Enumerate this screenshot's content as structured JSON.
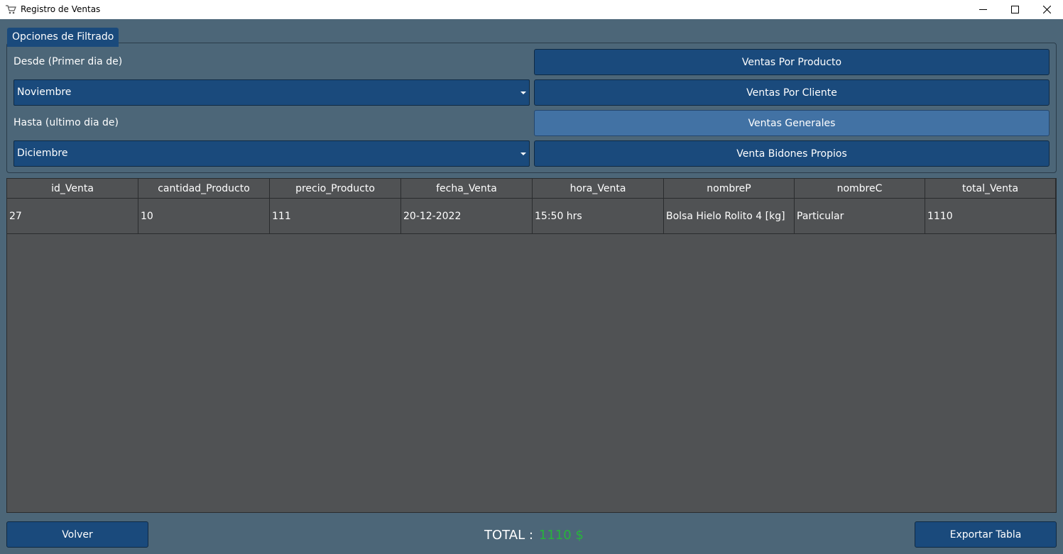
{
  "window": {
    "title": "Registro de Ventas",
    "app_icon": "cart-icon",
    "controls": [
      "minimize-icon",
      "maximize-icon",
      "close-icon"
    ]
  },
  "filter": {
    "group_title": "Opciones de Filtrado",
    "from_label": "Desde (Primer dia de)",
    "from_value": "Noviembre",
    "to_label": "Hasta (ultimo dia de)",
    "to_value": "Diciembre"
  },
  "buttons": {
    "by_product": "Ventas Por Producto",
    "by_client": "Ventas Por Cliente",
    "general": "Ventas Generales",
    "own_jugs": "Venta Bidones Propios",
    "back": "Volver",
    "export": "Exportar Tabla"
  },
  "table": {
    "columns": [
      "id_Venta",
      "cantidad_Producto",
      "precio_Producto",
      "fecha_Venta",
      "hora_Venta",
      "nombreP",
      "nombreC",
      "total_Venta"
    ],
    "rows": [
      [
        "27",
        "10",
        "111",
        "20-12-2022",
        "15:50 hrs",
        "Bolsa Hielo Rolito 4 [kg]",
        "Particular",
        "1110"
      ]
    ]
  },
  "summary": {
    "total_label": "TOTAL :",
    "total_value": "1110 $"
  },
  "colors": {
    "background": "#4c6678",
    "button": "#1a4a7c",
    "button_active": "#4272a4",
    "table_bg": "#505254",
    "total_value": "#27b43c"
  }
}
